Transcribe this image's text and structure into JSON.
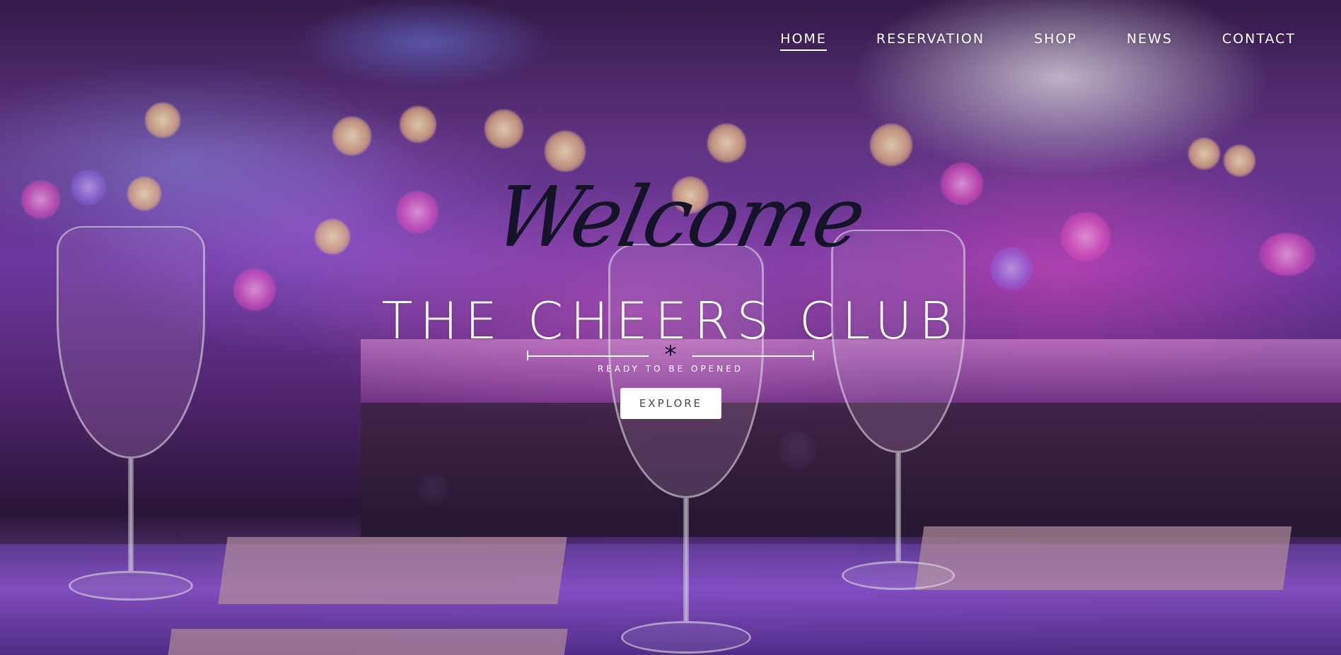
{
  "nav": {
    "items": [
      {
        "label": "HOME",
        "active": true
      },
      {
        "label": "RESERVATION",
        "active": false
      },
      {
        "label": "SHOP",
        "active": false
      },
      {
        "label": "NEWS",
        "active": false
      },
      {
        "label": "CONTACT",
        "active": false
      }
    ]
  },
  "hero": {
    "welcome": "Welcome",
    "title": "THE CHEERS CLUB",
    "divider_symbol": "*",
    "tagline": "READY TO BE OPENED",
    "cta_label": "EXPLORE"
  },
  "colors": {
    "nav_text": "#ffffff",
    "welcome_text": "#141428",
    "title_text": "#ffffff",
    "button_bg": "#ffffff",
    "button_text": "#4a4a4a"
  }
}
